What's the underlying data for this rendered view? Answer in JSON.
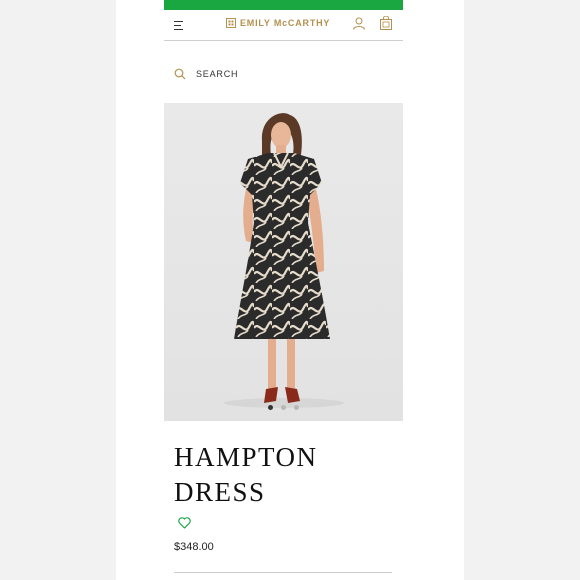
{
  "header": {
    "brand": "EMILY McCARTHY",
    "icons": [
      "menu-icon",
      "logo-mark-icon",
      "account-icon",
      "shopping-bag-icon"
    ]
  },
  "search": {
    "label": "SEARCH",
    "icon": "search-icon"
  },
  "product": {
    "title_line1": "HAMPTON",
    "title_line2": "DRESS",
    "price": "$348.00",
    "wishlist_icon": "heart-icon",
    "image_count": 3,
    "active_image_index": 0
  },
  "colors": {
    "promo_green": "#1aa640",
    "brand_gold": "#b4914e",
    "wishlist_green": "#1aa640"
  }
}
